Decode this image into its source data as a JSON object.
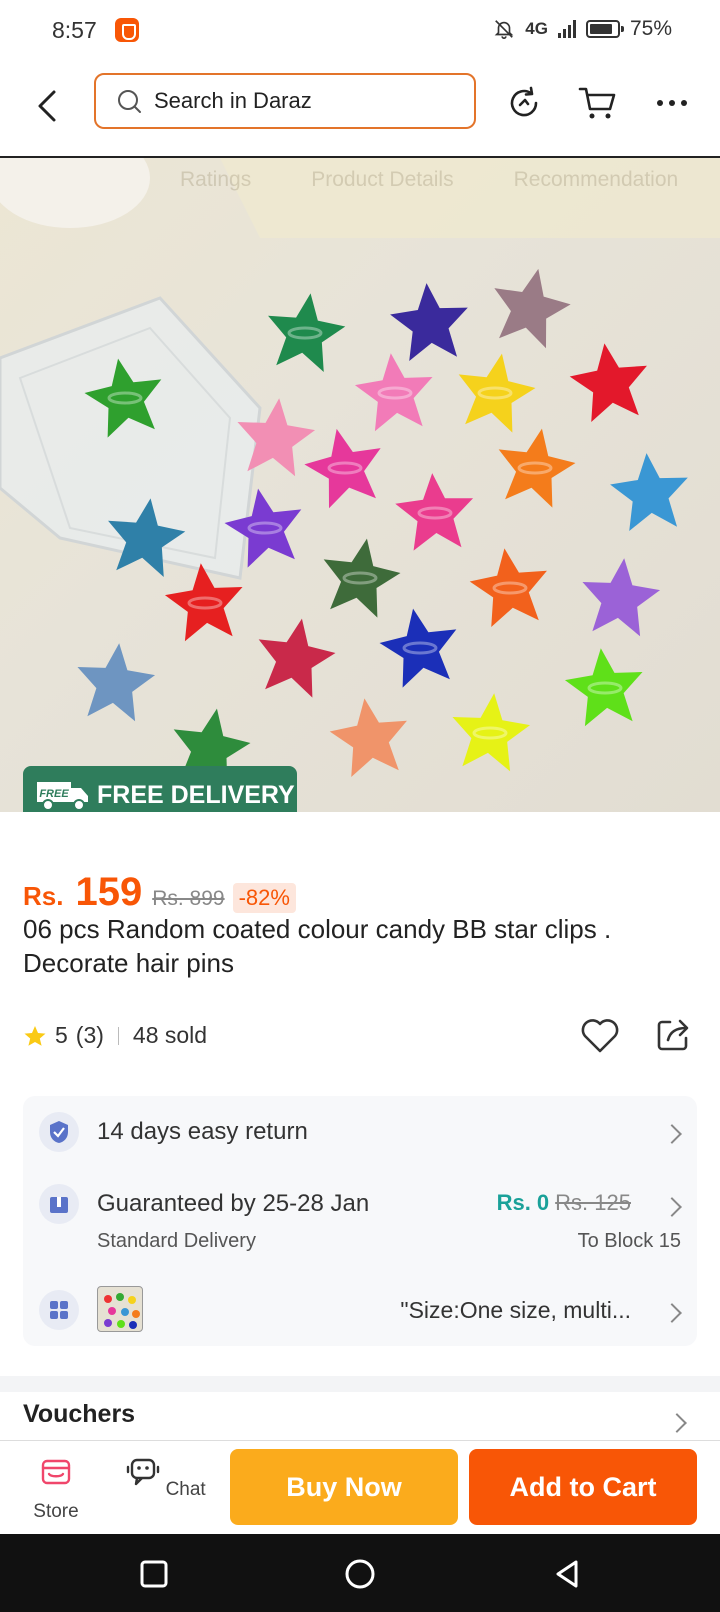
{
  "status_bar": {
    "time": "8:57",
    "network": "4G",
    "battery": "75%",
    "battery_level": 0.75
  },
  "header": {
    "search_placeholder": "Search in Daraz",
    "icons": [
      "back-icon",
      "search-icon",
      "history-icon",
      "cart-icon",
      "more-icon"
    ]
  },
  "hero": {
    "faint_tabs": [
      "Ratings",
      "Product Details",
      "Recommendation"
    ],
    "badge_truck_text": "FREE",
    "badge_label": "FREE DELIVERY"
  },
  "product": {
    "currency": "Rs.",
    "price": "159",
    "original_price": "Rs. 899",
    "discount": "-82%",
    "title": "06 pcs Random coated colour candy BB star clips . Decorate hair pins",
    "rating": "5",
    "rating_count": "(3)",
    "sold": "48 sold"
  },
  "services": {
    "return_text": "14 days easy return",
    "guarantee_text": "Guaranteed by 25-28 Jan",
    "delivery_type": "Standard Delivery",
    "delivery_fee": "Rs. 0",
    "delivery_fee_old": "Rs. 125",
    "delivery_to": "To Block 15",
    "variant_text": "\"Size:One size, multi..."
  },
  "vouchers": {
    "label": "Vouchers"
  },
  "bottom_bar": {
    "store_label": "Store",
    "chat_label": "Chat",
    "buy_now": "Buy Now",
    "add_to_cart": "Add to Cart"
  },
  "colors": {
    "brand_orange": "#f85606",
    "buy_yellow": "#fbab1c",
    "delivery_green": "#2f7d5c",
    "fee_teal": "#1aa199"
  }
}
